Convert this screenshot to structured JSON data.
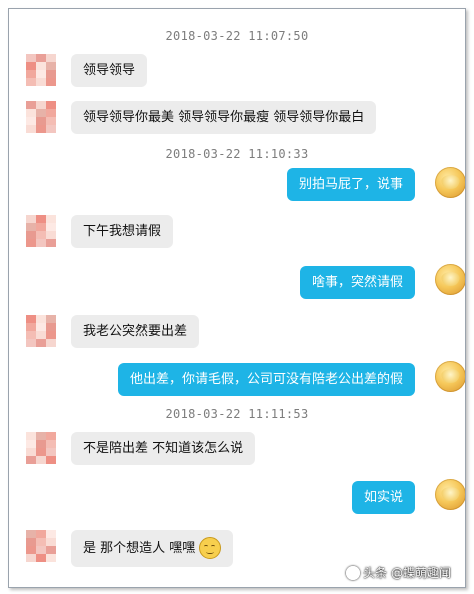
{
  "colors": {
    "incoming_bubble": "#ececec",
    "outgoing_bubble": "#1eb4e6",
    "timestamp": "#7d7d7d"
  },
  "chat": {
    "timestamps": [
      "2018-03-22 11:07:50",
      "2018-03-22 11:10:33",
      "2018-03-22 11:11:53"
    ],
    "messages": [
      {
        "side": "incoming",
        "text": "领导领导"
      },
      {
        "side": "incoming",
        "text": "领导领导你最美 领导领导你最瘦 领导领导你最白"
      },
      {
        "side": "outgoing",
        "text": "别拍马屁了，说事"
      },
      {
        "side": "incoming",
        "text": "下午我想请假"
      },
      {
        "side": "outgoing",
        "text": "啥事，突然请假"
      },
      {
        "side": "incoming",
        "text": "我老公突然要出差"
      },
      {
        "side": "outgoing",
        "text": "他出差，你请毛假，公司可没有陪老公出差的假"
      },
      {
        "side": "incoming",
        "text": "不是陪出差 不知道该怎么说"
      },
      {
        "side": "outgoing",
        "text": "如实说"
      },
      {
        "side": "incoming",
        "text": "是 那个想造人 嘿嘿",
        "emoji": "smirk-emoji"
      }
    ]
  },
  "watermark": {
    "text": "头条 @蝶萌趣闻",
    "icon": "toutiao-logo-icon"
  }
}
